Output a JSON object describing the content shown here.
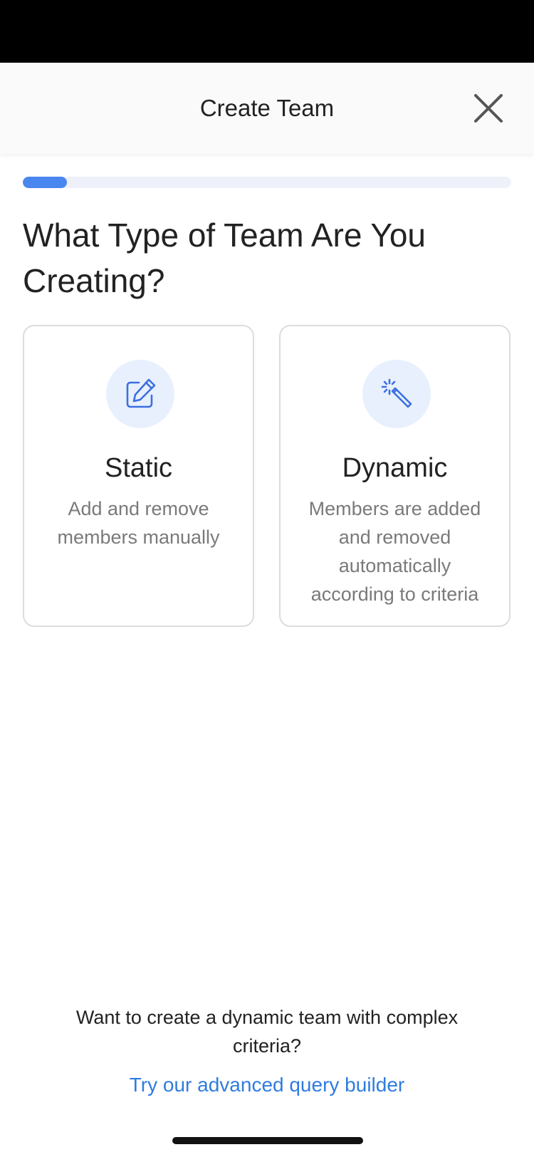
{
  "header": {
    "title": "Create Team"
  },
  "progress": {
    "fraction": 0.09
  },
  "question": "What Type of Team Are You Creating?",
  "cards": [
    {
      "title": "Static",
      "description": "Add and remove members manually",
      "icon": "edit-pencil-icon"
    },
    {
      "title": "Dynamic",
      "description": "Members are added and removed automatically according to criteria",
      "icon": "magic-wand-icon"
    }
  ],
  "footer": {
    "text": "Want to create a dynamic team with complex criteria?",
    "link": "Try our advanced query builder"
  },
  "colors": {
    "accent": "#4a86f0",
    "link": "#2f7ce0",
    "icon_bg": "#e8f0fe",
    "icon_stroke": "#3b6fe0"
  }
}
